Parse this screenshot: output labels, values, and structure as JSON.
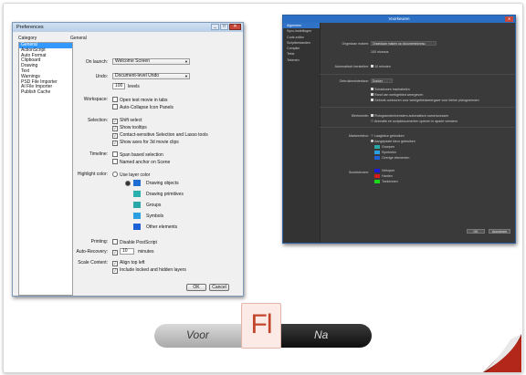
{
  "old_dialog": {
    "title": "Preferences",
    "category_header": "Category",
    "general_header": "General",
    "categories": [
      "General",
      "ActionScript",
      "Auto Format",
      "Clipboard",
      "Drawing",
      "Text",
      "Warnings",
      "PSD File Importer",
      "AI File Importer",
      "Publish Cache"
    ],
    "on_launch_label": "On launch:",
    "on_launch_value": "Welcome Screen",
    "undo_label": "Undo:",
    "undo_value": "Document-level Undo",
    "undo_levels_value": "100",
    "undo_levels_unit": "levels",
    "workspace_label": "Workspace:",
    "workspace_opt1": "Open test movie in tabs",
    "workspace_opt2": "Auto-Collapse Icon Panels",
    "selection_label": "Selection:",
    "selection_opt1": "Shift select",
    "selection_opt2": "Show tooltips",
    "selection_opt3": "Contact-sensitive Selection and Lasso tools",
    "selection_opt4": "Show axes for 3d movie clips",
    "timeline_label": "Timeline:",
    "timeline_opt1": "Span based selection",
    "timeline_opt2": "Named anchor on Scene",
    "highlight_label": "Highlight color:",
    "highlight_opt1": "Use layer color",
    "highlight_items": [
      {
        "label": "Drawing objects",
        "color": "#1f6ed4"
      },
      {
        "label": "Drawing primitives",
        "color": "#2bb0ad"
      },
      {
        "label": "Groups",
        "color": "#2aa8a8"
      },
      {
        "label": "Symbols",
        "color": "#2b9fe0"
      },
      {
        "label": "Other elements",
        "color": "#1e60d8"
      }
    ],
    "printing_label": "Printing:",
    "printing_opt1": "Disable PostScript",
    "autorecovery_label": "Auto-Recovery:",
    "autorecovery_value": "10",
    "autorecovery_unit": "minutes",
    "scale_label": "Scale Content:",
    "scale_opt1": "Align top left",
    "scale_opt2": "Include locked and hidden layers",
    "ok_label": "OK",
    "cancel_label": "Cancel"
  },
  "new_dialog": {
    "title": "Voorkeuren",
    "sidebar": [
      "Algemeen",
      "Sync-instellingen",
      "Code-editor",
      "Scriptbestanden",
      "Compiler",
      "Tekst",
      "Tekenen"
    ],
    "opgeven_label": "Ongedaan maken:",
    "opgeven_value": "Ongedaan maken op documentniveau",
    "levels_text": "100 niveaus",
    "autosave_label": "Automatisch herstellen:",
    "autosave_text": "10 minuten",
    "gebruiker_label": "Gebruikersinterface:",
    "gebruiker_value": "Donker",
    "gebruiker_opt1": "Schaduwen inschakelen",
    "gebruiker_opt2": "Rand van werkgebied weergeven",
    "gebruiker_opt3": "Gebruik contouren voor werkgebiedweergave voor kleine pictogrammen",
    "werkruimte_label": "Werkruimte:",
    "werkruimte_opt1": "Pictogramdeelvensters automatisch samenvouwen",
    "werkruimte_opt2": "Animatie en scriptdocumenten openen in aparte vensters",
    "markeren_label": "Markeerkleur:",
    "markeren_opt1": "Laagkleur gebruiken",
    "markeren_opt2": "Aangepaste kleur gebruiken",
    "markeren_items": [
      {
        "label": "Groepen",
        "color": "#2aa8a8"
      },
      {
        "label": "Symbolen",
        "color": "#2b9fe0"
      },
      {
        "label": "Overige elementen",
        "color": "#1e60d8"
      }
    ],
    "tijdlijn_label": "Scrubkleuren:",
    "tijdlijn_items": [
      {
        "label": "Verlopen",
        "color": "#1a1ad8"
      },
      {
        "label": "Harden",
        "color": "#d81a1a"
      },
      {
        "label": "Toekennen",
        "color": "#1ad81a"
      }
    ],
    "ok_label": "OK",
    "cancel_label": "Annuleren"
  },
  "toggle": {
    "left_label": "Voor",
    "right_label": "Na",
    "logo_text": "Fl"
  }
}
